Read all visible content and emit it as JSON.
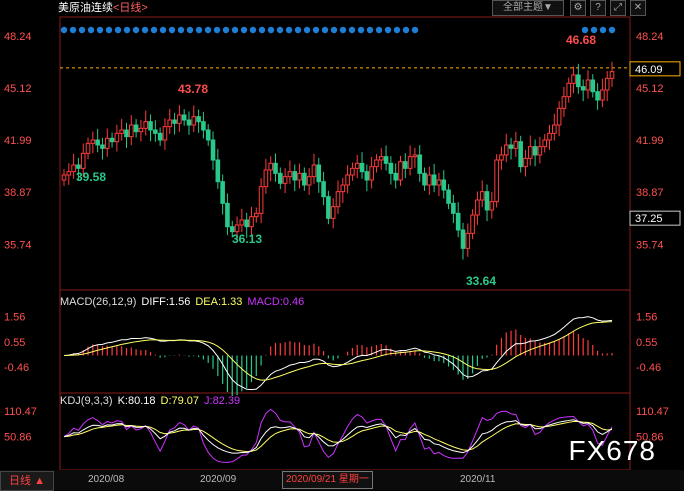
{
  "header": {
    "title": "美原油连续",
    "period": "<日线>",
    "theme_button": "全部主题▼",
    "icons": [
      "gear-icon",
      "help-icon",
      "expand-icon",
      "close-icon"
    ]
  },
  "price_axis": {
    "ticks": [
      "48.24",
      "45.12",
      "41.99",
      "38.87",
      "35.74"
    ],
    "current_price": "46.09",
    "crosshair_price": "37.25"
  },
  "annotations": {
    "high_left": "43.78",
    "low_start": "39.58",
    "low_mid": "36.13",
    "low_main": "33.64",
    "high_right": "46.68"
  },
  "macd": {
    "title": "MACD(26,12,9)",
    "diff": "DIFF:1.56",
    "dea": "DEA:1.33",
    "macd": "MACD:0.46",
    "ticks": [
      "1.56",
      "0.55",
      "-0.46"
    ]
  },
  "kdj": {
    "title": "KDJ(9,3,3)",
    "k": "K:80.18",
    "d": "D:79.07",
    "j": "J:82.39",
    "ticks": [
      "110.47",
      "50.86"
    ]
  },
  "bottom": {
    "period_button": "日线 ▲",
    "dates": [
      "2020/08",
      "2020/09",
      "2020/11"
    ],
    "crosshair_date": "2020/09/21 星期一"
  },
  "watermark": "FX678",
  "colors": {
    "up": "#ff3b3b",
    "down": "#28c98a",
    "diff": "#ffffff",
    "dea": "#ffff66",
    "j": "#cc33ff",
    "dot": "#1e7fd6"
  },
  "chart_data": {
    "type": "candlestick",
    "price_scale": [
      33.0,
      48.6
    ],
    "closes": [
      39.9,
      40.1,
      40.5,
      40.3,
      41.2,
      41.8,
      42.0,
      41.7,
      41.5,
      42.1,
      41.9,
      42.4,
      42.6,
      42.2,
      42.9,
      42.5,
      42.7,
      43.1,
      42.6,
      42.4,
      42.0,
      42.8,
      43.2,
      43.0,
      43.5,
      43.2,
      42.9,
      43.4,
      43.1,
      42.6,
      42.0,
      40.8,
      39.5,
      38.2,
      36.8,
      36.5,
      36.9,
      37.2,
      36.8,
      37.4,
      37.6,
      39.2,
      40.2,
      40.6,
      40.0,
      39.4,
      39.8,
      40.1,
      39.6,
      40.0,
      39.3,
      39.8,
      40.5,
      39.5,
      38.6,
      37.3,
      38.0,
      38.9,
      39.3,
      39.9,
      40.3,
      40.6,
      40.1,
      39.6,
      40.4,
      40.8,
      41.0,
      40.6,
      40.0,
      39.6,
      40.7,
      40.3,
      41.0,
      41.1,
      40.0,
      39.3,
      39.9,
      39.3,
      39.6,
      39.0,
      38.2,
      37.6,
      36.6,
      35.5,
      36.4,
      37.5,
      38.4,
      38.9,
      37.8,
      38.3,
      40.8,
      41.1,
      41.7,
      41.5,
      41.9,
      40.4,
      40.9,
      41.6,
      41.1,
      41.6,
      42.0,
      42.4,
      42.9,
      43.9,
      44.6,
      45.4,
      45.9,
      45.2,
      45.0,
      45.6,
      44.9,
      44.4,
      45.0,
      45.7,
      46.1
    ],
    "date_labels": [
      "2020/08",
      "2020/09",
      "2020/11"
    ]
  }
}
